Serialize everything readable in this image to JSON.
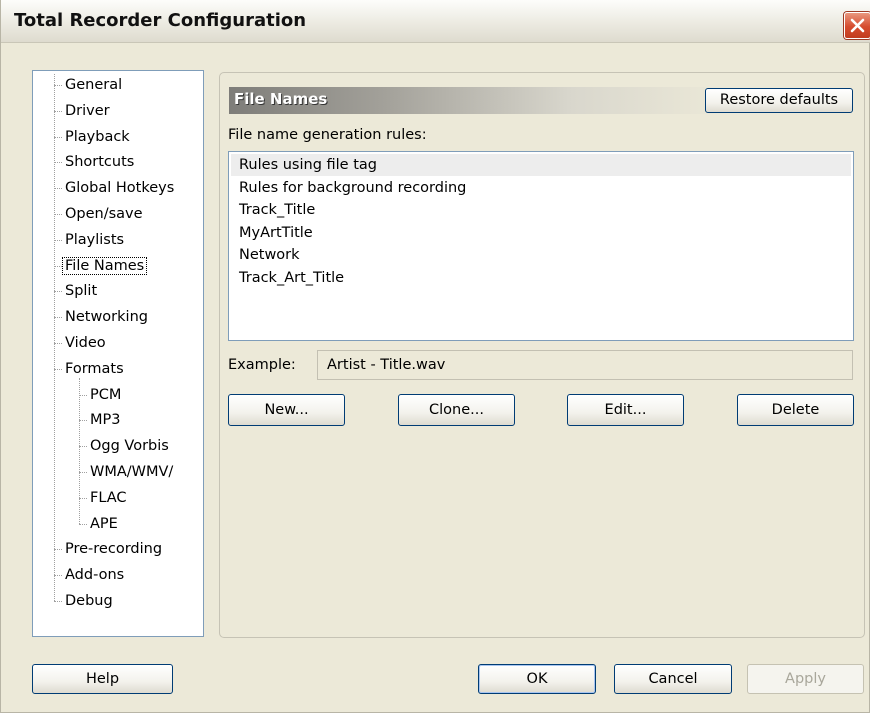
{
  "window": {
    "title": "Total Recorder Configuration"
  },
  "tree": {
    "items": [
      {
        "label": "General",
        "level": 0
      },
      {
        "label": "Driver",
        "level": 0
      },
      {
        "label": "Playback",
        "level": 0
      },
      {
        "label": "Shortcuts",
        "level": 0
      },
      {
        "label": "Global Hotkeys",
        "level": 0
      },
      {
        "label": "Open/save",
        "level": 0
      },
      {
        "label": "Playlists",
        "level": 0
      },
      {
        "label": "File Names",
        "level": 0,
        "selected": true
      },
      {
        "label": "Split",
        "level": 0
      },
      {
        "label": "Networking",
        "level": 0
      },
      {
        "label": "Video",
        "level": 0
      },
      {
        "label": "Formats",
        "level": 0
      },
      {
        "label": "PCM",
        "level": 1
      },
      {
        "label": "MP3",
        "level": 1
      },
      {
        "label": "Ogg Vorbis",
        "level": 1
      },
      {
        "label": "WMA/WMV/",
        "level": 1
      },
      {
        "label": "FLAC",
        "level": 1
      },
      {
        "label": "APE",
        "level": 1
      },
      {
        "label": "Pre-recording",
        "level": 0
      },
      {
        "label": "Add-ons",
        "level": 0
      },
      {
        "label": "Debug",
        "level": 0
      }
    ]
  },
  "panel": {
    "title": "File Names",
    "restore_label": "Restore defaults",
    "rules_label": "File name generation rules:",
    "rules": [
      {
        "label": "Rules using file tag",
        "selected": true
      },
      {
        "label": "Rules for background recording"
      },
      {
        "label": "Track_Title"
      },
      {
        "label": "MyArtTitle"
      },
      {
        "label": "Network"
      },
      {
        "label": "Track_Art_Title"
      }
    ],
    "example_label": "Example:",
    "example_value": "Artist - Title.wav",
    "new_label": "New...",
    "clone_label": "Clone...",
    "edit_label": "Edit...",
    "delete_label": "Delete"
  },
  "footer": {
    "help_label": "Help",
    "ok_label": "OK",
    "cancel_label": "Cancel",
    "apply_label": "Apply"
  }
}
